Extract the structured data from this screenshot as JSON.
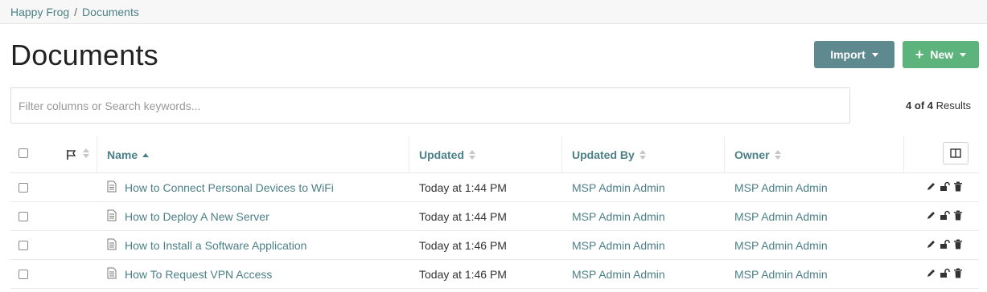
{
  "breadcrumb": {
    "root": "Happy Frog",
    "separator": "/",
    "current": "Documents"
  },
  "page_title": "Documents",
  "toolbar": {
    "import_label": "Import",
    "new_label": "New",
    "new_icon": "+"
  },
  "search": {
    "placeholder": "Filter columns or Search keywords...",
    "value": ""
  },
  "results": {
    "count": "4 of 4",
    "label": "Results"
  },
  "table": {
    "columns": {
      "name": "Name",
      "updated": "Updated",
      "updated_by": "Updated By",
      "owner": "Owner"
    },
    "sort": {
      "column": "Name",
      "direction": "ascending"
    },
    "rows": [
      {
        "name": "How to Connect Personal Devices to WiFi",
        "updated": "Today at 1:44 PM",
        "updated_by": "MSP Admin Admin",
        "owner": "MSP Admin Admin"
      },
      {
        "name": "How to Deploy A New Server",
        "updated": "Today at 1:44 PM",
        "updated_by": "MSP Admin Admin",
        "owner": "MSP Admin Admin"
      },
      {
        "name": "How to Install a Software Application",
        "updated": "Today at 1:46 PM",
        "updated_by": "MSP Admin Admin",
        "owner": "MSP Admin Admin"
      },
      {
        "name": "How To Request VPN Access",
        "updated": "Today at 1:46 PM",
        "updated_by": "MSP Admin Admin",
        "owner": "MSP Admin Admin"
      }
    ]
  },
  "icons": {
    "flag": "flag-icon",
    "document": "document-icon",
    "edit": "pencil-icon",
    "lock": "unlock-icon",
    "delete": "trash-icon",
    "columns": "columns-icon"
  },
  "colors": {
    "link": "#4b7f86",
    "import_button": "#5e8a8f",
    "new_button": "#5cb37c"
  }
}
